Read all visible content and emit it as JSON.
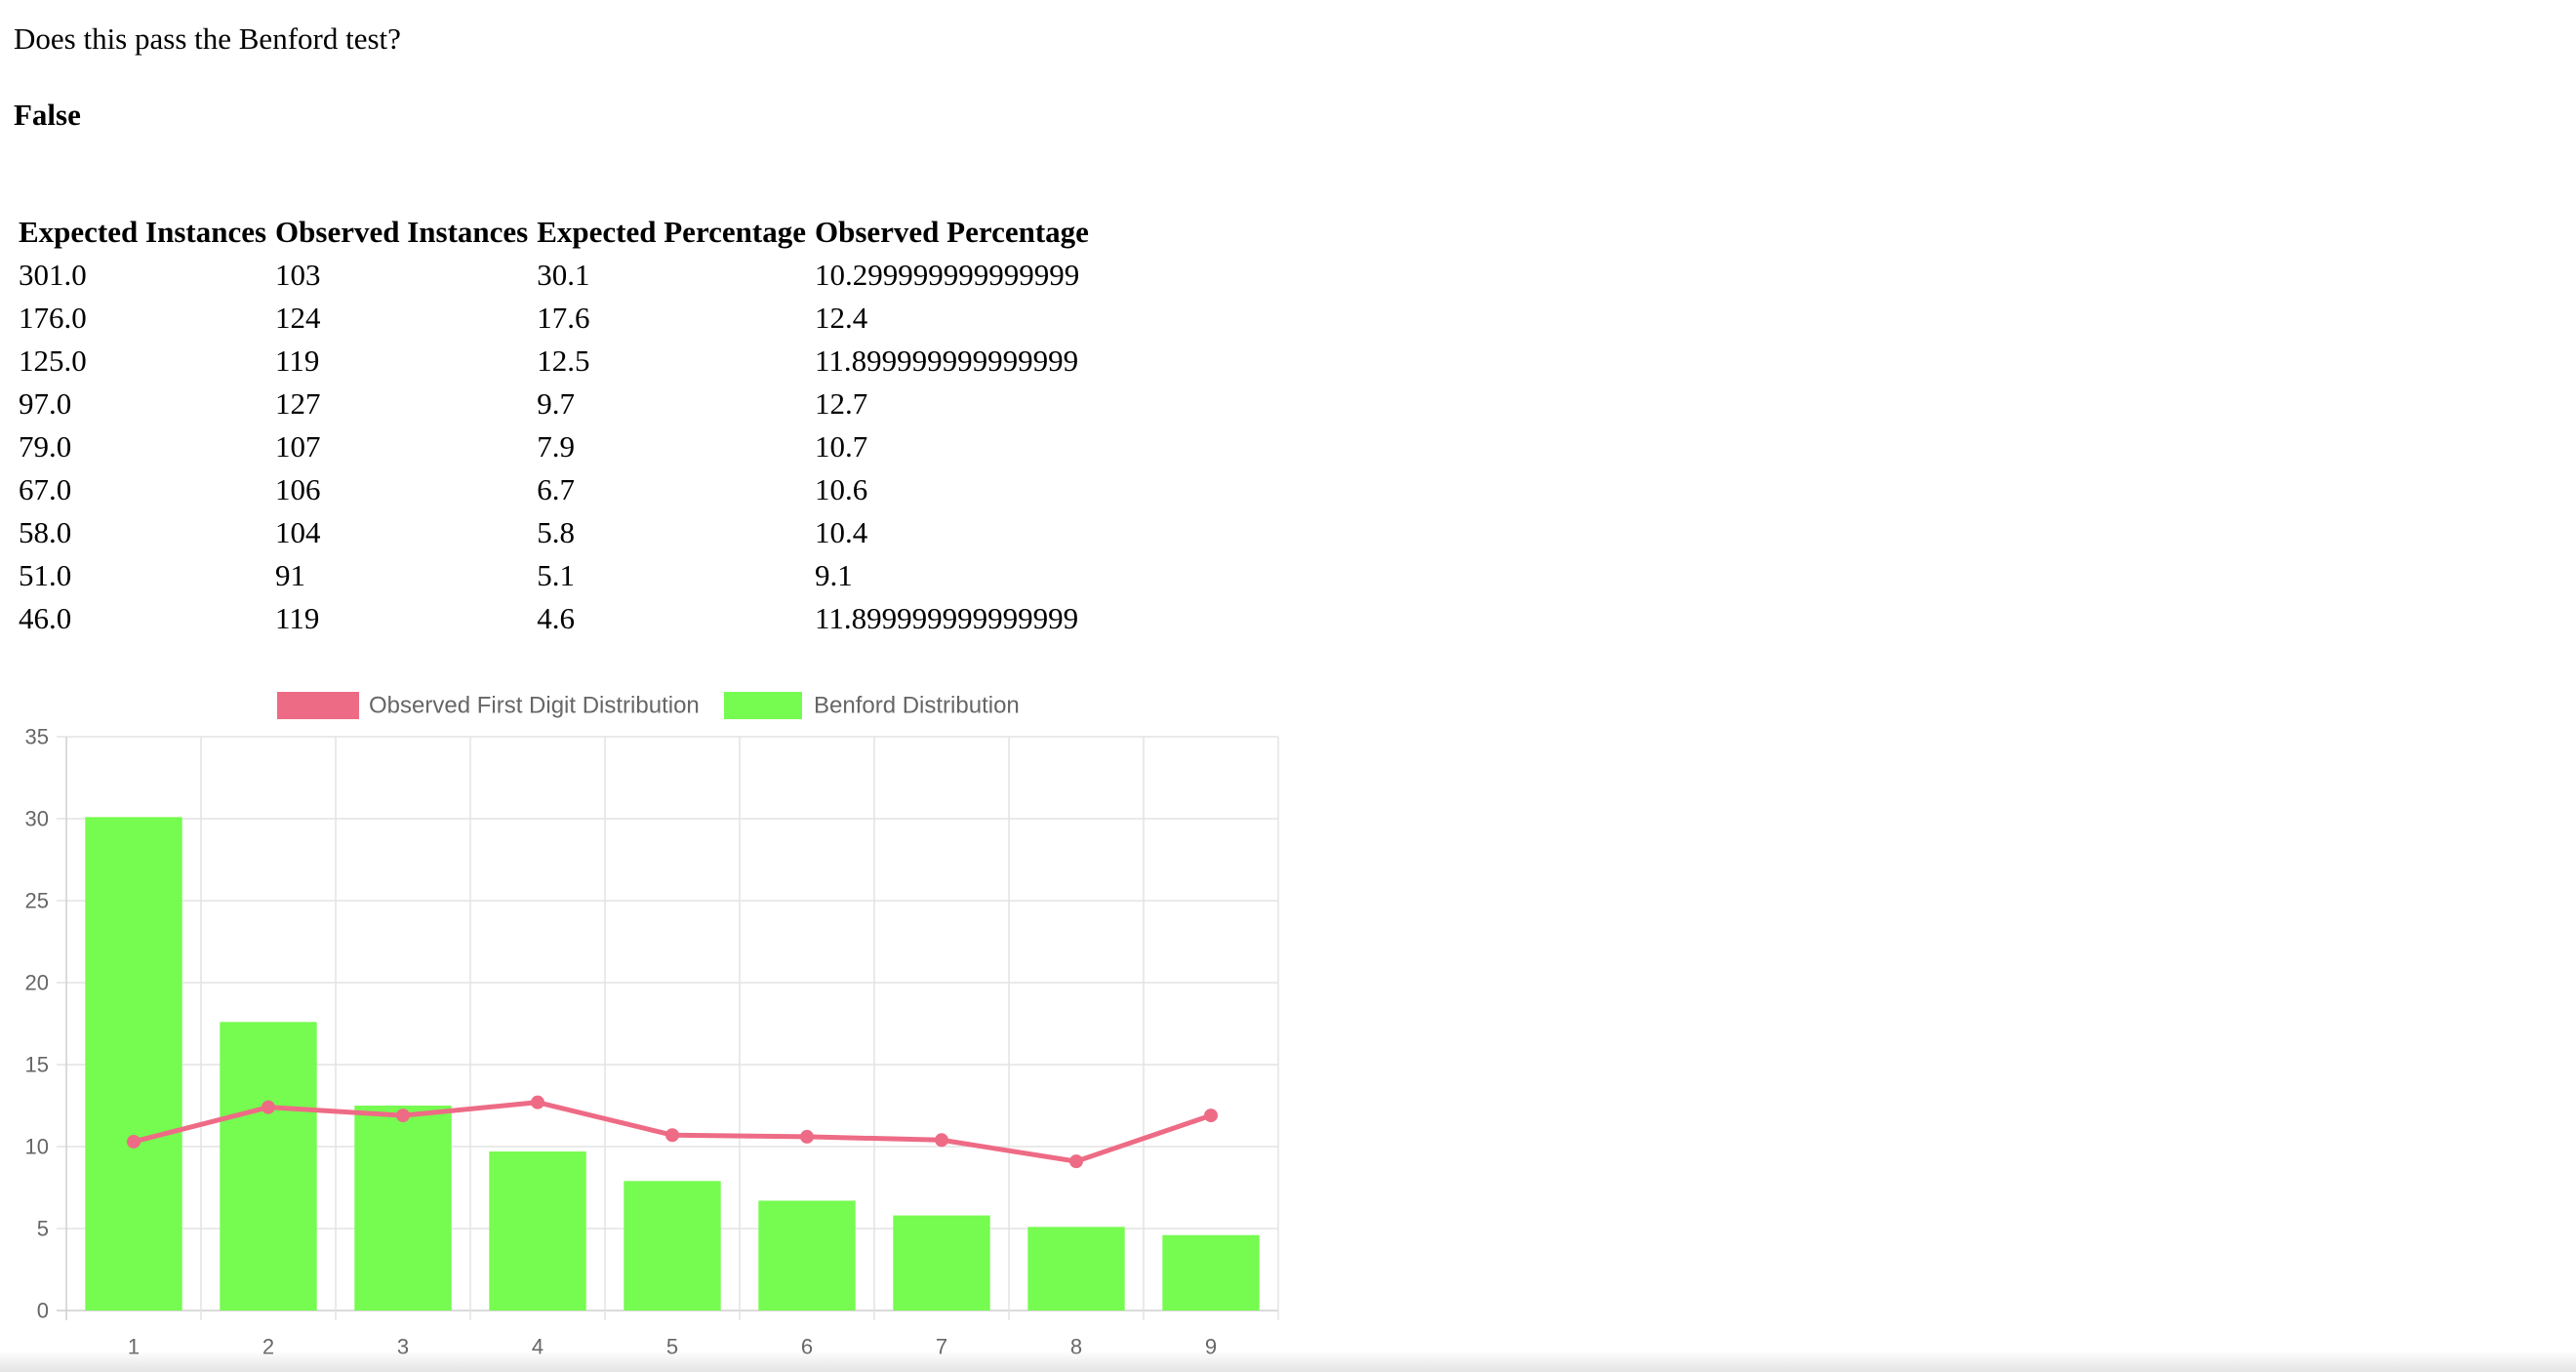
{
  "question": "Does this pass the Benford test?",
  "result": "False",
  "table": {
    "headers": [
      "Expected Instances",
      "Observed Instances",
      "Expected Percentage",
      "Observed Percentage"
    ],
    "rows": [
      [
        "301.0",
        "103",
        "30.1",
        "10.299999999999999"
      ],
      [
        "176.0",
        "124",
        "17.6",
        "12.4"
      ],
      [
        "125.0",
        "119",
        "12.5",
        "11.899999999999999"
      ],
      [
        "97.0",
        "127",
        "9.7",
        "12.7"
      ],
      [
        "79.0",
        "107",
        "7.9",
        "10.7"
      ],
      [
        "67.0",
        "106",
        "6.7",
        "10.6"
      ],
      [
        "58.0",
        "104",
        "5.8",
        "10.4"
      ],
      [
        "51.0",
        "91",
        "5.1",
        "9.1"
      ],
      [
        "46.0",
        "119",
        "4.6",
        "11.899999999999999"
      ]
    ]
  },
  "chart_data": {
    "type": "bar",
    "categories": [
      "1",
      "2",
      "3",
      "4",
      "5",
      "6",
      "7",
      "8",
      "9"
    ],
    "series": [
      {
        "name": "Observed First Digit Distribution",
        "type": "line",
        "color": "#ee6b85",
        "values": [
          10.3,
          12.4,
          11.9,
          12.7,
          10.7,
          10.6,
          10.4,
          9.1,
          11.9
        ]
      },
      {
        "name": "Benford Distribution",
        "type": "bar",
        "color": "#76fb50",
        "values": [
          30.1,
          17.6,
          12.5,
          9.7,
          7.9,
          6.7,
          5.8,
          5.1,
          4.6
        ]
      }
    ],
    "yticks": [
      "0",
      "5",
      "10",
      "15",
      "20",
      "25",
      "30",
      "35"
    ],
    "ylim": [
      0,
      35
    ],
    "grid": true,
    "legend": "top"
  }
}
